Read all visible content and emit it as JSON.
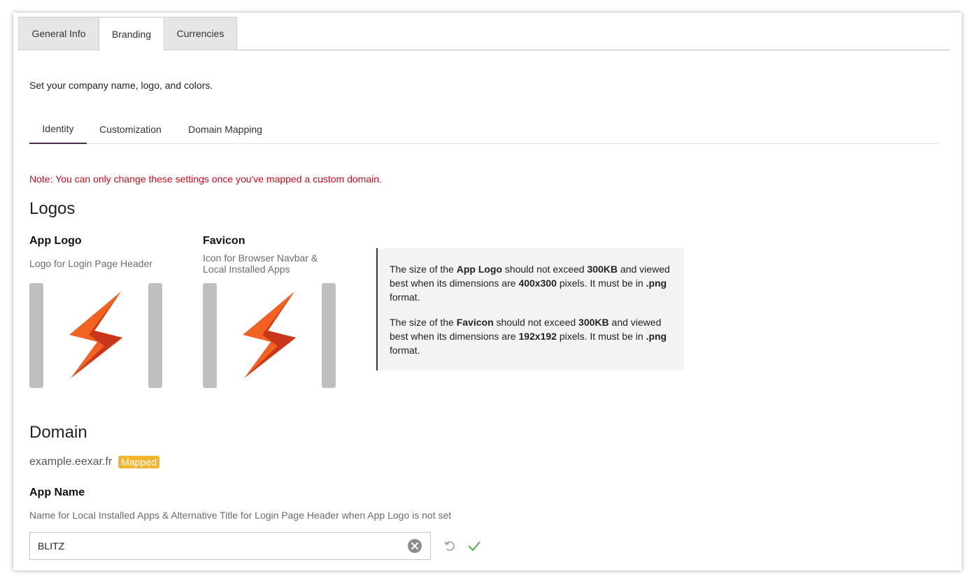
{
  "top_tabs": [
    {
      "label": "General Info",
      "active": false
    },
    {
      "label": "Branding",
      "active": true
    },
    {
      "label": "Currencies",
      "active": false
    }
  ],
  "intro": "Set your company name, logo, and colors.",
  "sub_tabs": [
    {
      "label": "Identity",
      "active": true
    },
    {
      "label": "Customization",
      "active": false
    },
    {
      "label": "Domain Mapping",
      "active": false
    }
  ],
  "note": "Note: You can only change these settings once you've mapped a custom domain.",
  "logos": {
    "heading": "Logos",
    "app_logo": {
      "title": "App Logo",
      "description": "Logo for Login Page Header",
      "icon": "lightning-bolt-icon"
    },
    "favicon": {
      "title": "Favicon",
      "description_line1": "Icon for Browser Navbar &",
      "description_line2": "Local Installed Apps",
      "icon": "lightning-bolt-icon"
    },
    "info": {
      "p1": {
        "a": "The size of the ",
        "b": "App Logo",
        "c": " should not exceed ",
        "d": "300KB",
        "e": " and viewed best when its dimensions are ",
        "f": "400x300",
        "g": " pixels. It must be in ",
        "h": ".png",
        "i": " format."
      },
      "p2": {
        "a": "The size of the ",
        "b": "Favicon",
        "c": " should not exceed ",
        "d": "300KB",
        "e": " and viewed best when its dimensions are ",
        "f": "192x192",
        "g": " pixels. It must be in ",
        "h": ".png",
        "i": " format."
      }
    }
  },
  "domain": {
    "heading": "Domain",
    "value": "example.eexar.fr",
    "status": "Mapped"
  },
  "app_name": {
    "title": "App Name",
    "description": "Name for Local Installed Apps & Alternative Title for Login Page Header when App Logo is not set",
    "value": "BLITZ"
  },
  "colors": {
    "accent": "#4a2b4a",
    "note": "#c1121f",
    "badge": "#f3b52e",
    "confirm": "#4caf50"
  }
}
